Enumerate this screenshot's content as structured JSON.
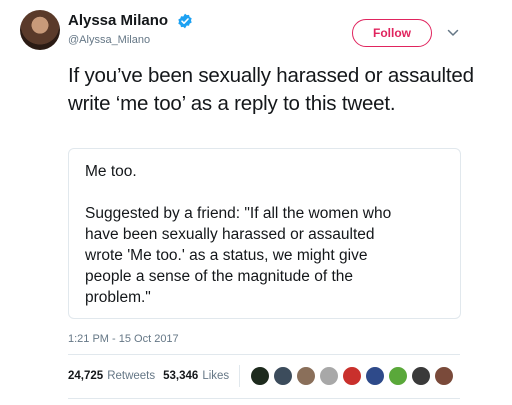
{
  "user": {
    "display_name": "Alyssa Milano",
    "handle": "@Alyssa_Milano",
    "verified": true
  },
  "follow_button": {
    "label": "Follow"
  },
  "tweet": {
    "text": "If you’ve been sexually harassed or assaulted write ‘me too’ as a reply to this tweet."
  },
  "quote": {
    "line1": "Me too.",
    "body_lines": [
      "Suggested by a friend: \"If all the women who",
      "have been sexually harassed or assaulted",
      "wrote 'Me too.' as a status, we might give",
      "people a sense of the magnitude of the",
      "problem.\""
    ]
  },
  "timestamp": "1:21 PM - 15 Oct 2017",
  "stats": {
    "retweets_count": "24,725",
    "retweets_label": "Retweets",
    "likes_count": "53,346",
    "likes_label": "Likes"
  },
  "liker_avatars": [
    {
      "icon": "avatar-1",
      "color": "#1d2a1d"
    },
    {
      "icon": "avatar-2",
      "color": "#3c4c5c"
    },
    {
      "icon": "avatar-3",
      "color": "#8a6f5a"
    },
    {
      "icon": "avatar-4",
      "color": "#a8a8a8"
    },
    {
      "icon": "avatar-5",
      "color": "#c9302c"
    },
    {
      "icon": "avatar-6",
      "color": "#2e4a8a"
    },
    {
      "icon": "avatar-7",
      "color": "#5aa83a"
    },
    {
      "icon": "avatar-8",
      "color": "#3a3a3a"
    },
    {
      "icon": "avatar-9",
      "color": "#7a4a3a"
    }
  ],
  "colors": {
    "accent": "#e0245e",
    "verified": "#1da1f2",
    "muted": "#657786",
    "border": "#e1e8ed"
  }
}
